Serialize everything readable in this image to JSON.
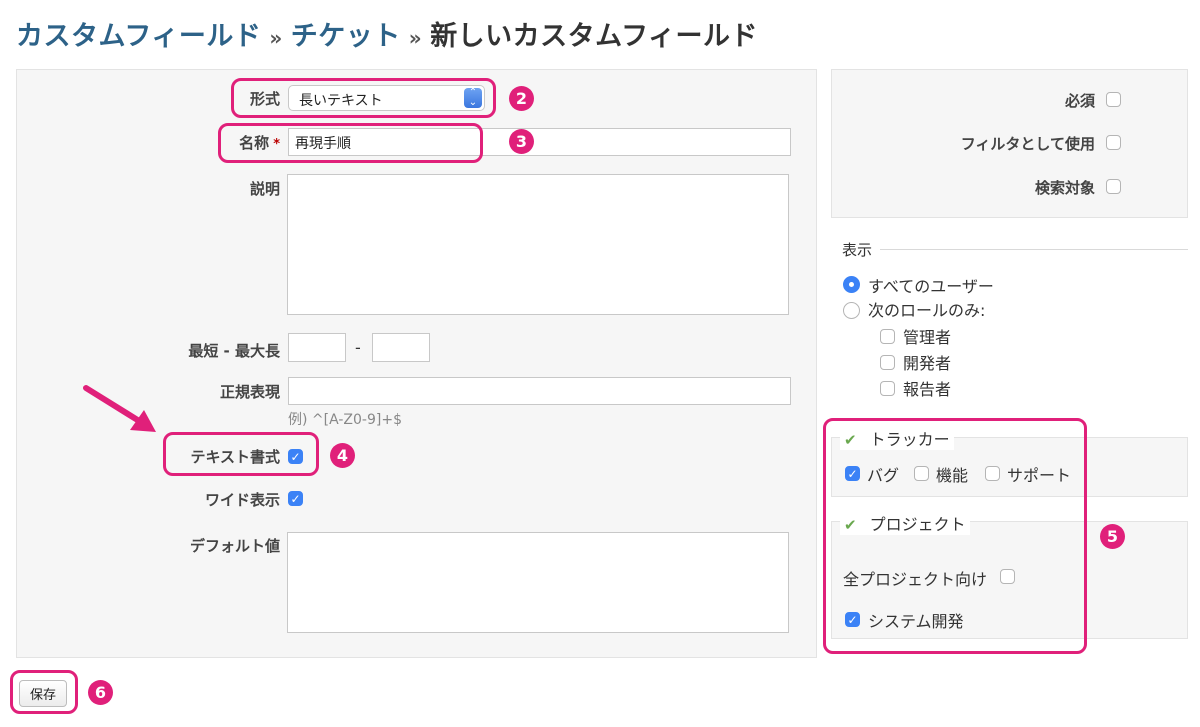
{
  "breadcrumb": {
    "part1": "カスタムフィールド",
    "sep": "»",
    "part2": "チケット",
    "current": "新しいカスタムフィールド"
  },
  "form": {
    "format_label": "形式",
    "format_value": "長いテキスト",
    "name_label": "名称",
    "name_required_mark": "*",
    "name_value": "再現手順",
    "description_label": "説明",
    "description_value": "",
    "length_label": "最短 - 最大長",
    "length_min": "",
    "length_dash": "-",
    "length_max": "",
    "regex_label": "正規表現",
    "regex_value": "",
    "regex_hint": "例) ^[A-Z0-9]+$",
    "text_format_label": "テキスト書式",
    "wide_label": "ワイド表示",
    "default_label": "デフォルト値",
    "default_value": ""
  },
  "options": {
    "required_label": "必須",
    "filter_label": "フィルタとして使用",
    "searchable_label": "検索対象"
  },
  "visibility": {
    "legend": "表示",
    "all_users": "すべてのユーザー",
    "roles_only": "次のロールのみ:",
    "roles": [
      "管理者",
      "開発者",
      "報告者"
    ]
  },
  "trackers": {
    "legend": "トラッカー",
    "items": [
      "バグ",
      "機能",
      "サポート"
    ]
  },
  "projects": {
    "legend": "プロジェクト",
    "all_projects": "全プロジェクト向け",
    "items": [
      "システム開発"
    ]
  },
  "save_label": "保存",
  "badges": [
    "2",
    "3",
    "4",
    "5",
    "6"
  ],
  "icons": {
    "checkmark": "check-icon",
    "checkbox_check": "✓",
    "arrow": "pointer-arrow"
  },
  "colors": {
    "highlight": "#e0207a",
    "link": "#2d6288",
    "accent": "#3b82f6",
    "check_green": "#6aa84f"
  }
}
